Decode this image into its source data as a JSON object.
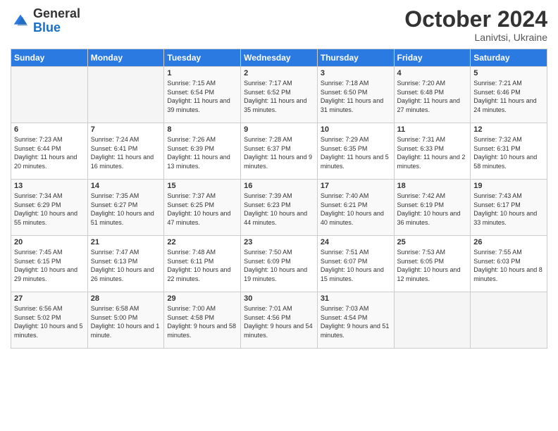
{
  "logo": {
    "general": "General",
    "blue": "Blue"
  },
  "header": {
    "month": "October 2024",
    "location": "Lanivtsi, Ukraine"
  },
  "days_of_week": [
    "Sunday",
    "Monday",
    "Tuesday",
    "Wednesday",
    "Thursday",
    "Friday",
    "Saturday"
  ],
  "weeks": [
    [
      {
        "day": "",
        "empty": true
      },
      {
        "day": "",
        "empty": true
      },
      {
        "day": "1",
        "sunrise": "7:15 AM",
        "sunset": "6:54 PM",
        "daylight": "11 hours and 39 minutes."
      },
      {
        "day": "2",
        "sunrise": "7:17 AM",
        "sunset": "6:52 PM",
        "daylight": "11 hours and 35 minutes."
      },
      {
        "day": "3",
        "sunrise": "7:18 AM",
        "sunset": "6:50 PM",
        "daylight": "11 hours and 31 minutes."
      },
      {
        "day": "4",
        "sunrise": "7:20 AM",
        "sunset": "6:48 PM",
        "daylight": "11 hours and 27 minutes."
      },
      {
        "day": "5",
        "sunrise": "7:21 AM",
        "sunset": "6:46 PM",
        "daylight": "11 hours and 24 minutes."
      }
    ],
    [
      {
        "day": "6",
        "sunrise": "7:23 AM",
        "sunset": "6:44 PM",
        "daylight": "11 hours and 20 minutes."
      },
      {
        "day": "7",
        "sunrise": "7:24 AM",
        "sunset": "6:41 PM",
        "daylight": "11 hours and 16 minutes."
      },
      {
        "day": "8",
        "sunrise": "7:26 AM",
        "sunset": "6:39 PM",
        "daylight": "11 hours and 13 minutes."
      },
      {
        "day": "9",
        "sunrise": "7:28 AM",
        "sunset": "6:37 PM",
        "daylight": "11 hours and 9 minutes."
      },
      {
        "day": "10",
        "sunrise": "7:29 AM",
        "sunset": "6:35 PM",
        "daylight": "11 hours and 5 minutes."
      },
      {
        "day": "11",
        "sunrise": "7:31 AM",
        "sunset": "6:33 PM",
        "daylight": "11 hours and 2 minutes."
      },
      {
        "day": "12",
        "sunrise": "7:32 AM",
        "sunset": "6:31 PM",
        "daylight": "10 hours and 58 minutes."
      }
    ],
    [
      {
        "day": "13",
        "sunrise": "7:34 AM",
        "sunset": "6:29 PM",
        "daylight": "10 hours and 55 minutes."
      },
      {
        "day": "14",
        "sunrise": "7:35 AM",
        "sunset": "6:27 PM",
        "daylight": "10 hours and 51 minutes."
      },
      {
        "day": "15",
        "sunrise": "7:37 AM",
        "sunset": "6:25 PM",
        "daylight": "10 hours and 47 minutes."
      },
      {
        "day": "16",
        "sunrise": "7:39 AM",
        "sunset": "6:23 PM",
        "daylight": "10 hours and 44 minutes."
      },
      {
        "day": "17",
        "sunrise": "7:40 AM",
        "sunset": "6:21 PM",
        "daylight": "10 hours and 40 minutes."
      },
      {
        "day": "18",
        "sunrise": "7:42 AM",
        "sunset": "6:19 PM",
        "daylight": "10 hours and 36 minutes."
      },
      {
        "day": "19",
        "sunrise": "7:43 AM",
        "sunset": "6:17 PM",
        "daylight": "10 hours and 33 minutes."
      }
    ],
    [
      {
        "day": "20",
        "sunrise": "7:45 AM",
        "sunset": "6:15 PM",
        "daylight": "10 hours and 29 minutes."
      },
      {
        "day": "21",
        "sunrise": "7:47 AM",
        "sunset": "6:13 PM",
        "daylight": "10 hours and 26 minutes."
      },
      {
        "day": "22",
        "sunrise": "7:48 AM",
        "sunset": "6:11 PM",
        "daylight": "10 hours and 22 minutes."
      },
      {
        "day": "23",
        "sunrise": "7:50 AM",
        "sunset": "6:09 PM",
        "daylight": "10 hours and 19 minutes."
      },
      {
        "day": "24",
        "sunrise": "7:51 AM",
        "sunset": "6:07 PM",
        "daylight": "10 hours and 15 minutes."
      },
      {
        "day": "25",
        "sunrise": "7:53 AM",
        "sunset": "6:05 PM",
        "daylight": "10 hours and 12 minutes."
      },
      {
        "day": "26",
        "sunrise": "7:55 AM",
        "sunset": "6:03 PM",
        "daylight": "10 hours and 8 minutes."
      }
    ],
    [
      {
        "day": "27",
        "sunrise": "6:56 AM",
        "sunset": "5:02 PM",
        "daylight": "10 hours and 5 minutes."
      },
      {
        "day": "28",
        "sunrise": "6:58 AM",
        "sunset": "5:00 PM",
        "daylight": "10 hours and 1 minute."
      },
      {
        "day": "29",
        "sunrise": "7:00 AM",
        "sunset": "4:58 PM",
        "daylight": "9 hours and 58 minutes."
      },
      {
        "day": "30",
        "sunrise": "7:01 AM",
        "sunset": "4:56 PM",
        "daylight": "9 hours and 54 minutes."
      },
      {
        "day": "31",
        "sunrise": "7:03 AM",
        "sunset": "4:54 PM",
        "daylight": "9 hours and 51 minutes."
      },
      {
        "day": "",
        "empty": true
      },
      {
        "day": "",
        "empty": true
      }
    ]
  ]
}
